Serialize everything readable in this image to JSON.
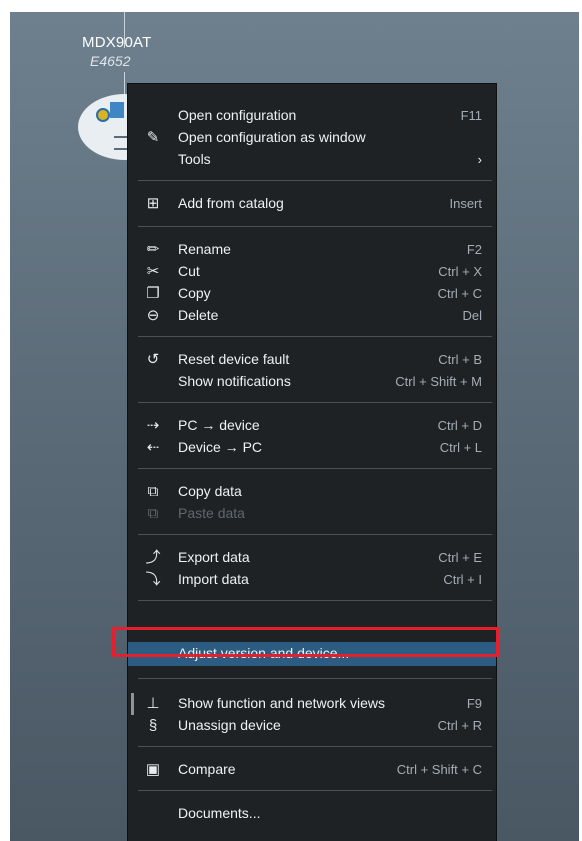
{
  "device": {
    "name": "MDX90AT",
    "code": "E4652"
  },
  "menu": {
    "items": [
      {
        "label": "Open configuration",
        "shortcut": "F11",
        "icon": "none"
      },
      {
        "label": "Open configuration as window",
        "shortcut": "",
        "icon": "window-edit-icon"
      },
      {
        "label": "Tools",
        "shortcut": "›",
        "icon": "none"
      },
      {
        "label": "Add from catalog",
        "shortcut": "Insert",
        "icon": "catalog-icon"
      },
      {
        "label": "Rename",
        "shortcut": "F2",
        "icon": "pencil-icon"
      },
      {
        "label": "Cut",
        "shortcut": "Ctrl + X",
        "icon": "scissors-icon"
      },
      {
        "label": "Copy",
        "shortcut": "Ctrl + C",
        "icon": "copy-icon"
      },
      {
        "label": "Delete",
        "shortcut": "Del",
        "icon": "minus-circle-icon"
      },
      {
        "label": "Reset device fault",
        "shortcut": "Ctrl + B",
        "icon": "reset-icon"
      },
      {
        "label": "Show notifications",
        "shortcut": "Ctrl + Shift + M",
        "icon": "none"
      },
      {
        "label": "PC → device",
        "shortcut": "Ctrl + D",
        "icon": "upload-icon"
      },
      {
        "label": "Device → PC",
        "shortcut": "Ctrl + L",
        "icon": "download-icon"
      },
      {
        "label": "Copy data",
        "shortcut": "",
        "icon": "copy-data-icon"
      },
      {
        "label": "Paste data",
        "shortcut": "",
        "icon": "paste-data-icon",
        "disabled": true
      },
      {
        "label": "Export data",
        "shortcut": "Ctrl + E",
        "icon": "export-icon"
      },
      {
        "label": "Import data",
        "shortcut": "Ctrl + I",
        "icon": "import-icon"
      },
      {
        "label": "Adjust version and device...",
        "shortcut": "",
        "icon": "none",
        "highlighted": true
      },
      {
        "label": "Show function and network views",
        "shortcut": "F9",
        "icon": "network-icon"
      },
      {
        "label": "Unassign device",
        "shortcut": "Ctrl + R",
        "icon": "unassign-icon"
      },
      {
        "label": "Compare",
        "shortcut": "Ctrl + Shift + C",
        "icon": "compare-icon"
      },
      {
        "label": "Documents...",
        "shortcut": "",
        "icon": "none"
      }
    ]
  },
  "colors": {
    "menu_bg": "#1f2225",
    "highlight": "#2d5c82",
    "callout": "#e3202b"
  }
}
